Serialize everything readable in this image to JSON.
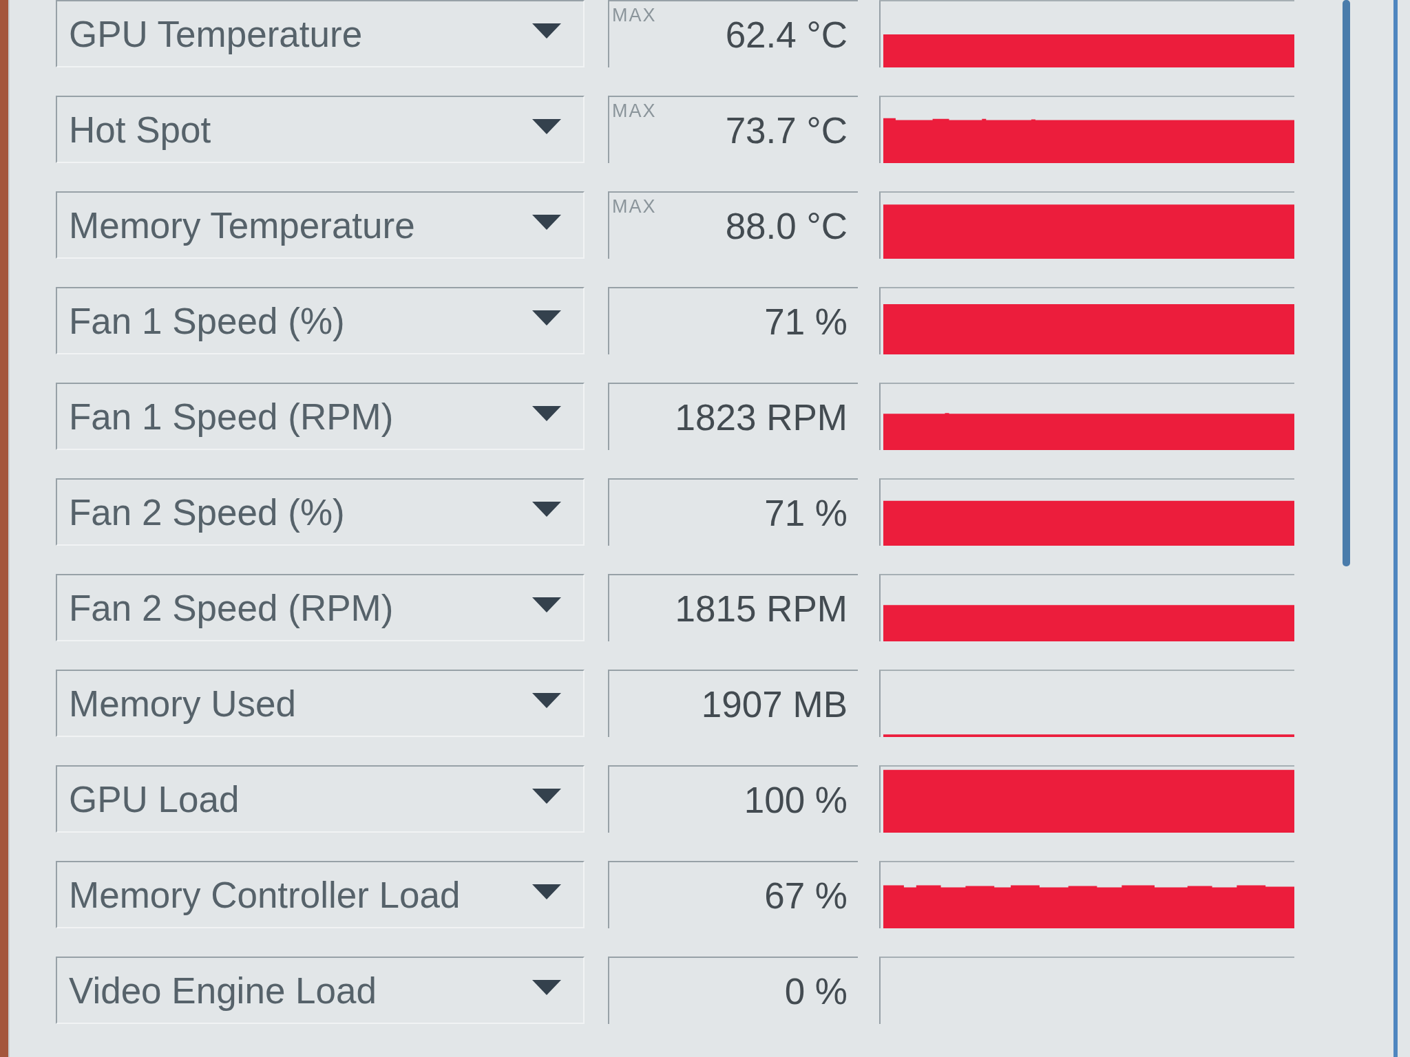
{
  "sensors": [
    {
      "name": "GPU Temperature",
      "display_mode": "MAX",
      "reading": "62.4 °C"
    },
    {
      "name": "Hot Spot",
      "display_mode": "MAX",
      "reading": "73.7 °C"
    },
    {
      "name": "Memory Temperature",
      "display_mode": "MAX",
      "reading": "88.0 °C"
    },
    {
      "name": "Fan 1 Speed (%)",
      "reading": "71 %"
    },
    {
      "name": "Fan 1 Speed (RPM)",
      "reading": "1823 RPM"
    },
    {
      "name": "Fan 2 Speed (%)",
      "reading": "71 %"
    },
    {
      "name": "Fan 2 Speed (RPM)",
      "reading": "1815 RPM"
    },
    {
      "name": "Memory Used",
      "reading": "1907 MB"
    },
    {
      "name": "GPU Load",
      "reading": "100 %"
    },
    {
      "name": "Memory Controller Load",
      "reading": "67 %"
    },
    {
      "name": "Video Engine Load",
      "reading": "0 %"
    }
  ]
}
